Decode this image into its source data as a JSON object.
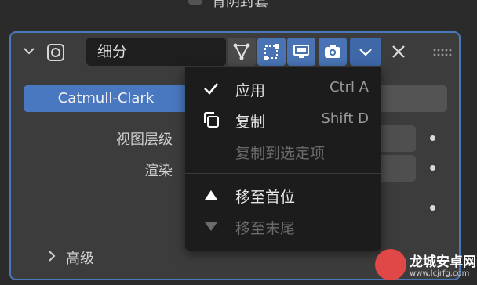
{
  "top": {
    "label": "背阴封套"
  },
  "modifier": {
    "name": "细分",
    "buttons": {
      "edit_mode": "edit-mode-icon",
      "on_cage": "cage-icon",
      "viewport": "monitor-icon",
      "render": "camera-icon",
      "more": "chevron-down-icon",
      "close": "close-icon"
    }
  },
  "subdivision": {
    "type_active": "Catmull-Clark",
    "levels_viewport_label": "视图层级",
    "render_label": "渲染",
    "advanced_label": "高级"
  },
  "menu": {
    "items": [
      {
        "icon": "check-icon",
        "label": "应用",
        "shortcut": "Ctrl A",
        "enabled": true
      },
      {
        "icon": "copy-icon",
        "label": "复制",
        "shortcut": "Shift D",
        "enabled": true
      },
      {
        "icon": "",
        "label": "复制到选定项",
        "shortcut": "",
        "enabled": false
      },
      {
        "icon": "triangle-up-icon",
        "label": "移至首位",
        "shortcut": "",
        "enabled": true
      },
      {
        "icon": "triangle-down-icon",
        "label": "移至末尾",
        "shortcut": "",
        "enabled": false
      }
    ]
  },
  "watermark": {
    "title": "龙城安卓网",
    "url": "www.lcjrfg.com"
  },
  "colors": {
    "accent": "#4a78c0",
    "panel": "#3c3c3c",
    "menu_bg": "#1c1c1c",
    "border": "#4a79b8"
  }
}
